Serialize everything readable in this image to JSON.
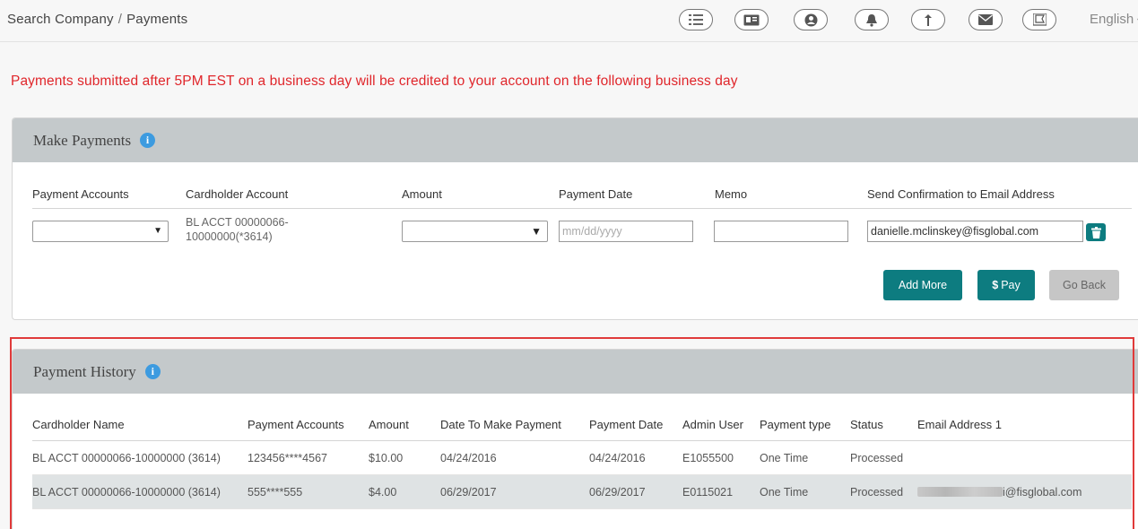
{
  "breadcrumb": {
    "parent": "Search Company",
    "separator": "/",
    "current": "Payments"
  },
  "toolbar": {
    "icons": [
      "checklist-icon",
      "id-card-icon",
      "user-circle-icon",
      "bell-icon",
      "upload-arrow-icon",
      "mail-icon",
      "flag-icon"
    ],
    "language": "English"
  },
  "notice": "Payments submitted after 5PM EST on a business day will be credited to your account on the following business day",
  "make_payments": {
    "title": "Make Payments",
    "columns": [
      "Payment Accounts",
      "Cardholder Account",
      "Amount",
      "Payment Date",
      "Memo",
      "Send Confirmation to Email Address"
    ],
    "row": {
      "payment_account_value": "",
      "cardholder_account": "BL ACCT 00000066-10000000(*3614)",
      "amount_value": "",
      "payment_date_placeholder": "mm/dd/yyyy",
      "memo_value": "",
      "email_value": "danielle.mclinskey@fisglobal.com"
    },
    "buttons": {
      "add_more": "Add More",
      "pay_symbol": "$",
      "pay": "Pay",
      "go_back": "Go Back"
    }
  },
  "payment_history": {
    "title": "Payment History",
    "columns": [
      "Cardholder Name",
      "Payment Accounts",
      "Amount",
      "Date To Make Payment",
      "Payment Date",
      "Admin User",
      "Payment type",
      "Status",
      "Email Address 1"
    ],
    "rows": [
      {
        "cardholder": "BL ACCT 00000066-10000000 (3614)",
        "account": "123456****4567",
        "amount": "$10.00",
        "date_to_make": "04/24/2016",
        "payment_date": "04/24/2016",
        "admin": "E1055500",
        "type": "One Time",
        "status": "Processed",
        "email": ""
      },
      {
        "cardholder": "BL ACCT 00000066-10000000 (3614)",
        "account": "555****555",
        "amount": "$4.00",
        "date_to_make": "06/29/2017",
        "payment_date": "06/29/2017",
        "admin": "E0115021",
        "type": "One Time",
        "status": "Processed",
        "email": "i@fisglobal.com"
      }
    ]
  },
  "colors": {
    "accent": "#0d7c80",
    "notice": "#e0262b",
    "panel_header": "#c4c9cb",
    "info": "#3d9be0",
    "highlight_border": "#e03a3a"
  }
}
